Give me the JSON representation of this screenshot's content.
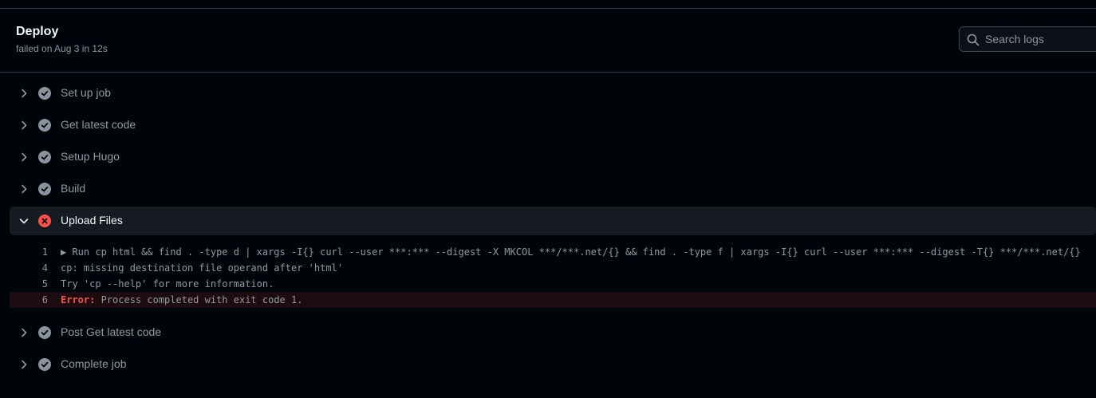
{
  "job": {
    "title": "Deploy",
    "subtitle": "failed on Aug 3 in 12s"
  },
  "search": {
    "placeholder": "Search logs",
    "icon": "search-icon"
  },
  "colors": {
    "success": "#8b949e",
    "failure": "#f85149",
    "background": "#010409",
    "border": "#30363d"
  },
  "steps": [
    {
      "label": "Set up job",
      "status": "success",
      "expanded": false
    },
    {
      "label": "Get latest code",
      "status": "success",
      "expanded": false
    },
    {
      "label": "Setup Hugo",
      "status": "success",
      "expanded": false
    },
    {
      "label": "Build",
      "status": "success",
      "expanded": false
    },
    {
      "label": "Upload Files",
      "status": "failure",
      "expanded": true
    },
    {
      "label": "Post Get latest code",
      "status": "success",
      "expanded": false
    },
    {
      "label": "Complete job",
      "status": "success",
      "expanded": false
    }
  ],
  "log": [
    {
      "line": "1",
      "text": "▶ Run cp html && find . -type d | xargs -I{} curl --user ***:*** --digest -X MKCOL ***/***.net/{} && find . -type f | xargs -I{} curl --user ***:*** --digest -T{} ***/***.net/{}"
    },
    {
      "line": "4",
      "text": "cp: missing destination file operand after 'html'"
    },
    {
      "line": "5",
      "text": "Try 'cp --help' for more information."
    },
    {
      "line": "6",
      "prefix": "Error:",
      "text": " Process completed with exit code 1."
    }
  ]
}
